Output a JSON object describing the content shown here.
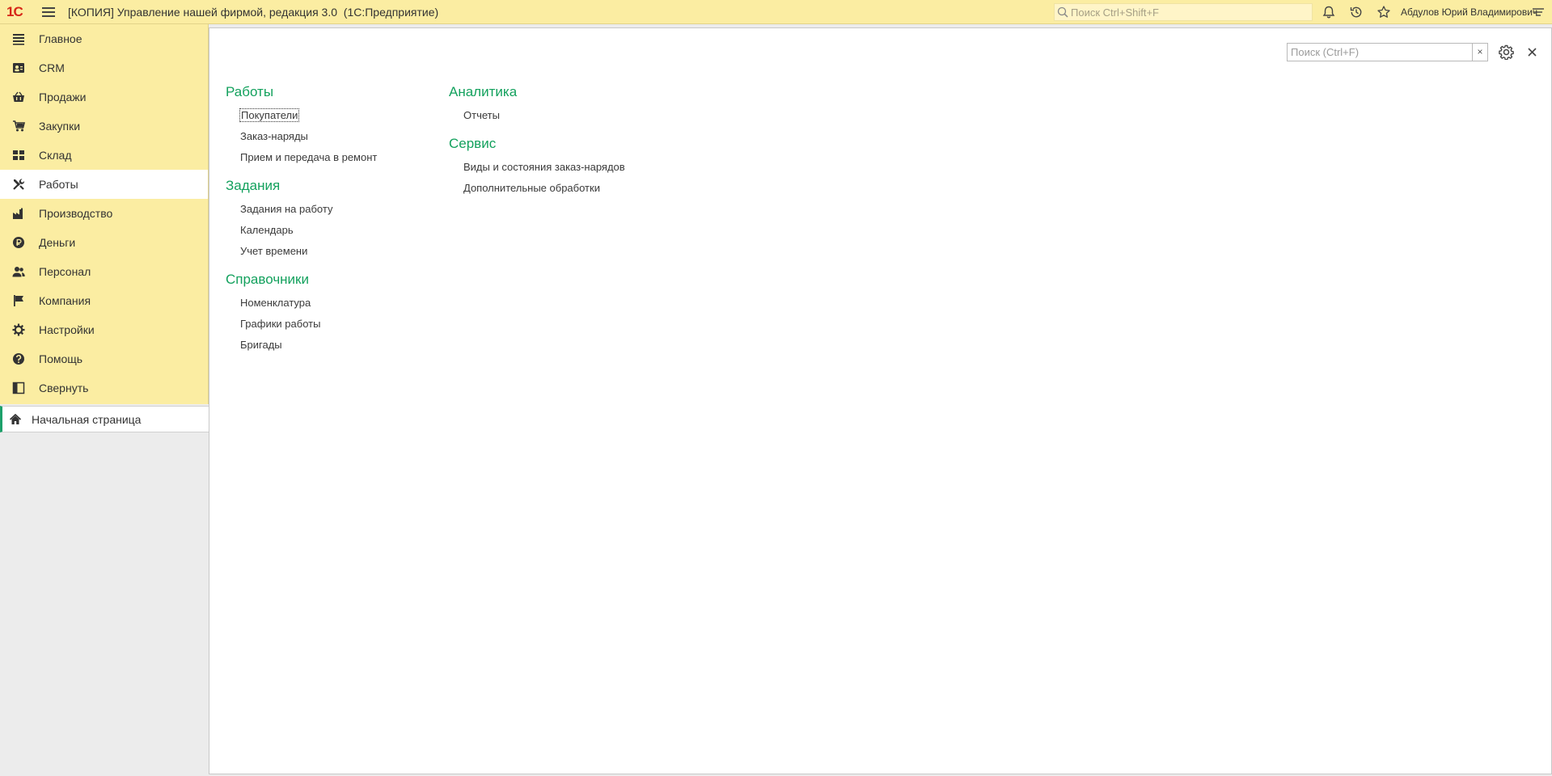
{
  "header": {
    "logo": "1С",
    "title": "[КОПИЯ] Управление нашей фирмой, редакция 3.0  (1С:Предприятие)",
    "search_placeholder": "Поиск Ctrl+Shift+F",
    "user": "Абдулов Юрий Владимирович"
  },
  "sidebar": {
    "items": [
      {
        "label": "Главное",
        "icon": "menu-lines-icon"
      },
      {
        "label": "CRM",
        "icon": "contact-card-icon"
      },
      {
        "label": "Продажи",
        "icon": "basket-icon"
      },
      {
        "label": "Закупки",
        "icon": "cart-icon"
      },
      {
        "label": "Склад",
        "icon": "grid-blocks-icon"
      },
      {
        "label": "Работы",
        "icon": "tools-icon",
        "active": true
      },
      {
        "label": "Производство",
        "icon": "factory-icon"
      },
      {
        "label": "Деньги",
        "icon": "ruble-icon"
      },
      {
        "label": "Персонал",
        "icon": "people-icon"
      },
      {
        "label": "Компания",
        "icon": "flag-icon"
      },
      {
        "label": "Настройки",
        "icon": "gear-icon"
      },
      {
        "label": "Помощь",
        "icon": "help-icon"
      },
      {
        "label": "Свернуть",
        "icon": "collapse-panel-icon"
      }
    ],
    "home_tab": "Начальная страница"
  },
  "main": {
    "search_placeholder": "Поиск (Ctrl+F)",
    "clear_label": "×",
    "groups_left": [
      {
        "title": "Работы",
        "links": [
          "Покупатели",
          "Заказ-наряды",
          "Прием и передача в ремонт"
        ]
      },
      {
        "title": "Задания",
        "links": [
          "Задания на работу",
          "Календарь",
          "Учет времени"
        ]
      },
      {
        "title": "Справочники",
        "links": [
          "Номенклатура",
          "Графики работы",
          "Бригады"
        ]
      }
    ],
    "groups_right": [
      {
        "title": "Аналитика",
        "links": [
          "Отчеты"
        ]
      },
      {
        "title": "Сервис",
        "links": [
          "Виды и состояния заказ-нарядов",
          "Дополнительные обработки"
        ]
      }
    ]
  },
  "colors": {
    "topbar_bg": "#fbeda2",
    "accent_green": "#13a15d",
    "logo_red": "#d62718"
  }
}
